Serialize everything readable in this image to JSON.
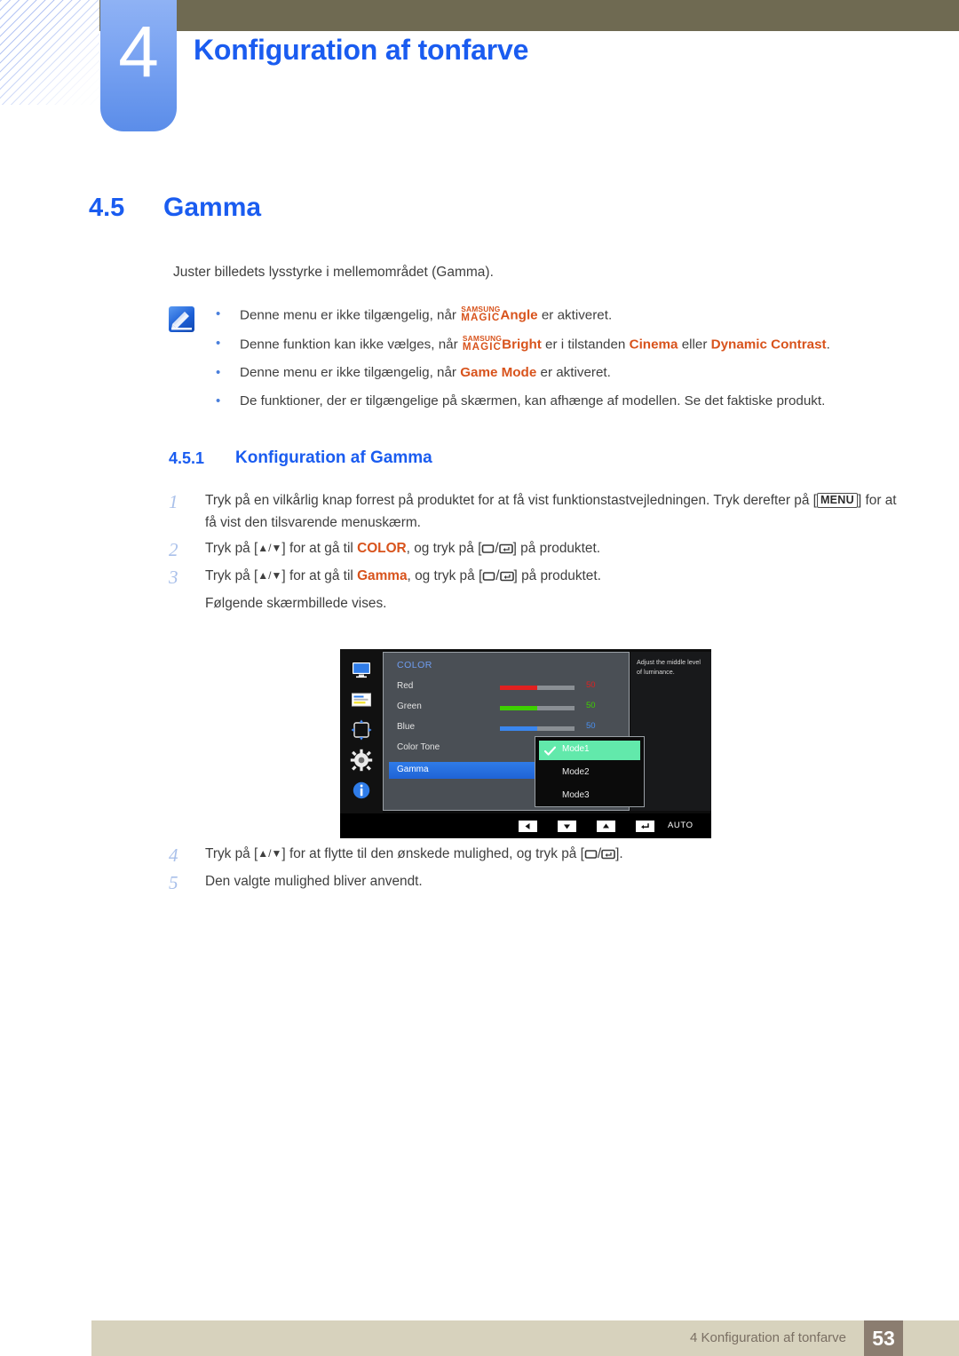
{
  "header": {
    "chapter_number": "4",
    "chapter_title": "Konfiguration af tonfarve"
  },
  "section": {
    "number": "4.5",
    "title": "Gamma",
    "intro": "Juster billedets lysstyrke i mellemområdet (Gamma)."
  },
  "notes": {
    "icon_name": "note-pencil-icon",
    "bullets": [
      {
        "pre": "Denne menu er ikke tilgængelig, når ",
        "magic_top": "SAMSUNG",
        "magic_bottom": "MAGIC",
        "magic_suffix": "Angle",
        "post": " er aktiveret.",
        "has_magic": true
      },
      {
        "pre": "Denne funktion kan ikke vælges, når ",
        "magic_top": "SAMSUNG",
        "magic_bottom": "MAGIC",
        "magic_suffix": "Bright",
        "post": " er i tilstanden ",
        "term1": "Cinema",
        "mid": " eller ",
        "term2": "Dynamic Contrast",
        "tail": ".",
        "has_magic": true
      },
      {
        "pre": "Denne menu er ikke tilgængelig, når ",
        "term1": "Game Mode",
        "post": " er aktiveret.",
        "has_magic": false
      },
      {
        "pre": "De funktioner, der er tilgængelige på skærmen, kan afhænge af modellen. Se det faktiske produkt.",
        "has_magic": false
      }
    ]
  },
  "subsection": {
    "number": "4.5.1",
    "title": "Konfiguration af Gamma"
  },
  "steps": {
    "s1": {
      "num": "1",
      "text_a": "Tryk på en vilkårlig knap forrest på produktet for at få vist funktionstastvejledningen. Tryk derefter på",
      "keycap": "MENU",
      "text_b": "for at få vist den tilsvarende menuskærm."
    },
    "s2": {
      "num": "2",
      "text_a": "Tryk på [",
      "arrows": "▲/▼",
      "text_b": "] for at gå til ",
      "target": "COLOR",
      "text_c": ", og tryk på [",
      "text_d": "] på produktet."
    },
    "s3": {
      "num": "3",
      "text_a": "Tryk på [",
      "arrows": "▲/▼",
      "text_b": "] for at gå til ",
      "target": "Gamma",
      "text_c": ", og tryk på [",
      "text_d": "] på produktet.",
      "sub": "Følgende skærmbillede vises."
    },
    "s4": {
      "num": "4",
      "text_a": "Tryk på [",
      "arrows": "▲/▼",
      "text_b": "] for at flytte til den ønskede mulighed, og tryk på [",
      "text_c": "]."
    },
    "s5": {
      "num": "5",
      "text": "Den valgte mulighed bliver anvendt."
    }
  },
  "osd": {
    "category": "COLOR",
    "rail_icons": [
      "monitor-icon",
      "picture-color-icon",
      "size-position-icon",
      "setup-gear-icon",
      "information-icon"
    ],
    "rows": [
      {
        "label": "Red",
        "value": "50",
        "color": "#e02020",
        "fill": 50,
        "selected": false,
        "has_slider": true
      },
      {
        "label": "Green",
        "value": "50",
        "color": "#3ed000",
        "fill": 50,
        "selected": false,
        "has_slider": true
      },
      {
        "label": "Blue",
        "value": "50",
        "color": "#3a86ee",
        "fill": 50,
        "selected": false,
        "has_slider": true
      },
      {
        "label": "Color Tone",
        "value": "",
        "color": "",
        "fill": 0,
        "selected": false,
        "has_slider": false
      },
      {
        "label": "Gamma",
        "value": "",
        "color": "",
        "fill": 0,
        "selected": true,
        "has_slider": false
      }
    ],
    "dropdown": {
      "items": [
        {
          "label": "Mode1",
          "checked": true
        },
        {
          "label": "Mode2",
          "checked": false
        },
        {
          "label": "Mode3",
          "checked": false
        }
      ],
      "highlight_color": "#62e9ab"
    },
    "help_text": "Adjust the middle level of luminance.",
    "bottom_buttons": [
      {
        "name": "left-arrow-button",
        "glyph": "◀"
      },
      {
        "name": "down-arrow-button",
        "glyph": "▼"
      },
      {
        "name": "up-arrow-button",
        "glyph": "▲"
      },
      {
        "name": "enter-button",
        "glyph": "↵"
      }
    ],
    "auto_label": "AUTO",
    "power_icon": "power-icon"
  },
  "footer": {
    "text": "4 Konfiguration af tonfarve",
    "page": "53"
  },
  "colors": {
    "heading_blue": "#1a5cf0",
    "accent_orange": "#d8531c",
    "olive": "#6f6a52",
    "footer_beige": "#d7d2bd",
    "page_box": "#8b7d70"
  }
}
